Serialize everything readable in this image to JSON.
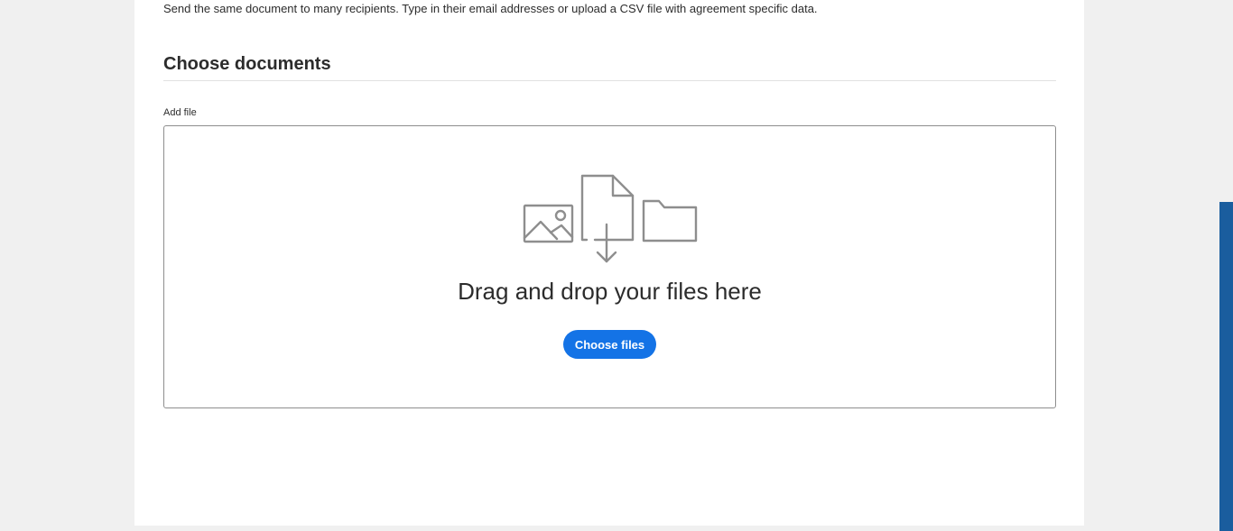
{
  "intro_text": "Send the same document to many recipients. Type in their email addresses or upload a CSV file with agreement specific data.",
  "section": {
    "title": "Choose documents"
  },
  "add_file": {
    "label": "Add file",
    "dropzone_text": "Drag and drop your files here",
    "choose_button": "Choose files",
    "icons": [
      "image-icon",
      "document-download-icon",
      "folder-icon"
    ]
  },
  "colors": {
    "accent": "#1473e6",
    "side_strip": "#1a5d9e",
    "page_background": "#f0f0f0"
  }
}
